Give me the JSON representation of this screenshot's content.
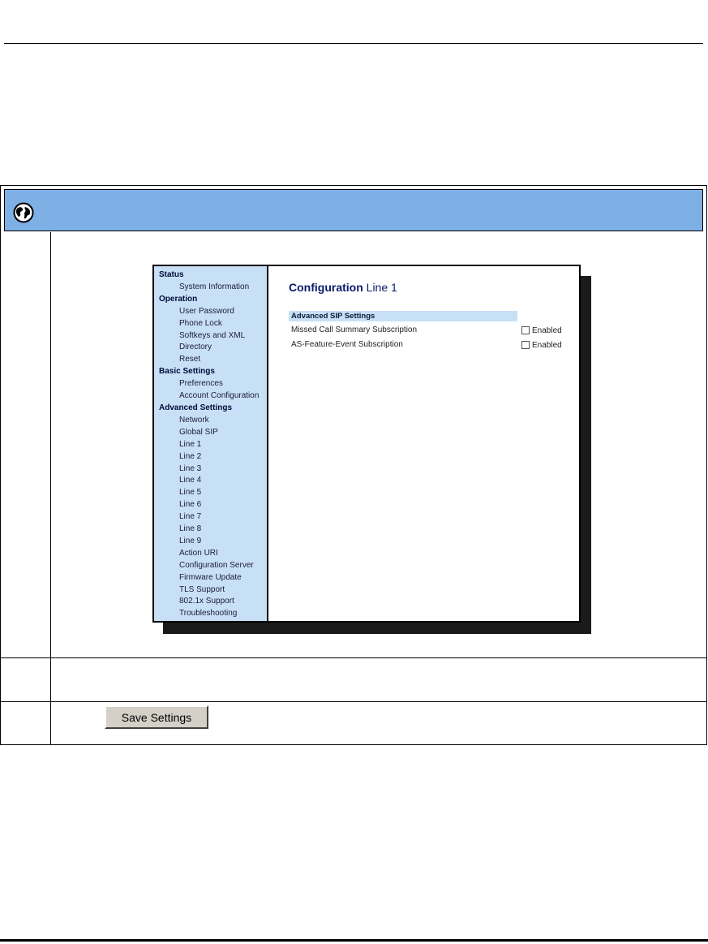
{
  "icons": {
    "header": "globe-icon"
  },
  "sidebar": {
    "groups": [
      {
        "label": "Status",
        "items": [
          "System Information"
        ]
      },
      {
        "label": "Operation",
        "items": [
          "User Password",
          "Phone Lock",
          "Softkeys and XML",
          "Directory",
          "Reset"
        ]
      },
      {
        "label": "Basic Settings",
        "items": [
          "Preferences",
          "Account Configuration"
        ]
      },
      {
        "label": "Advanced Settings",
        "items": [
          "Network",
          "Global SIP",
          "Line 1",
          "Line 2",
          "Line 3",
          "Line 4",
          "Line 5",
          "Line 6",
          "Line 7",
          "Line 8",
          "Line 9",
          "Action URI",
          "Configuration Server",
          "Firmware Update",
          "TLS Support",
          "802.1x Support",
          "Troubleshooting"
        ]
      }
    ]
  },
  "main": {
    "title_bold": "Configuration",
    "title_rest": "Line 1",
    "section": "Advanced SIP Settings",
    "settings": [
      {
        "label": "Missed Call Summary Subscription",
        "checkbox_label": "Enabled",
        "checked": false
      },
      {
        "label": "AS-Feature-Event Subscription",
        "checkbox_label": "Enabled",
        "checked": false
      }
    ]
  },
  "save_button": "Save Settings",
  "colors": {
    "header_bar": "#7eb0e6",
    "sidebar": "#c8e0f6",
    "title": "#0a1a6a"
  }
}
